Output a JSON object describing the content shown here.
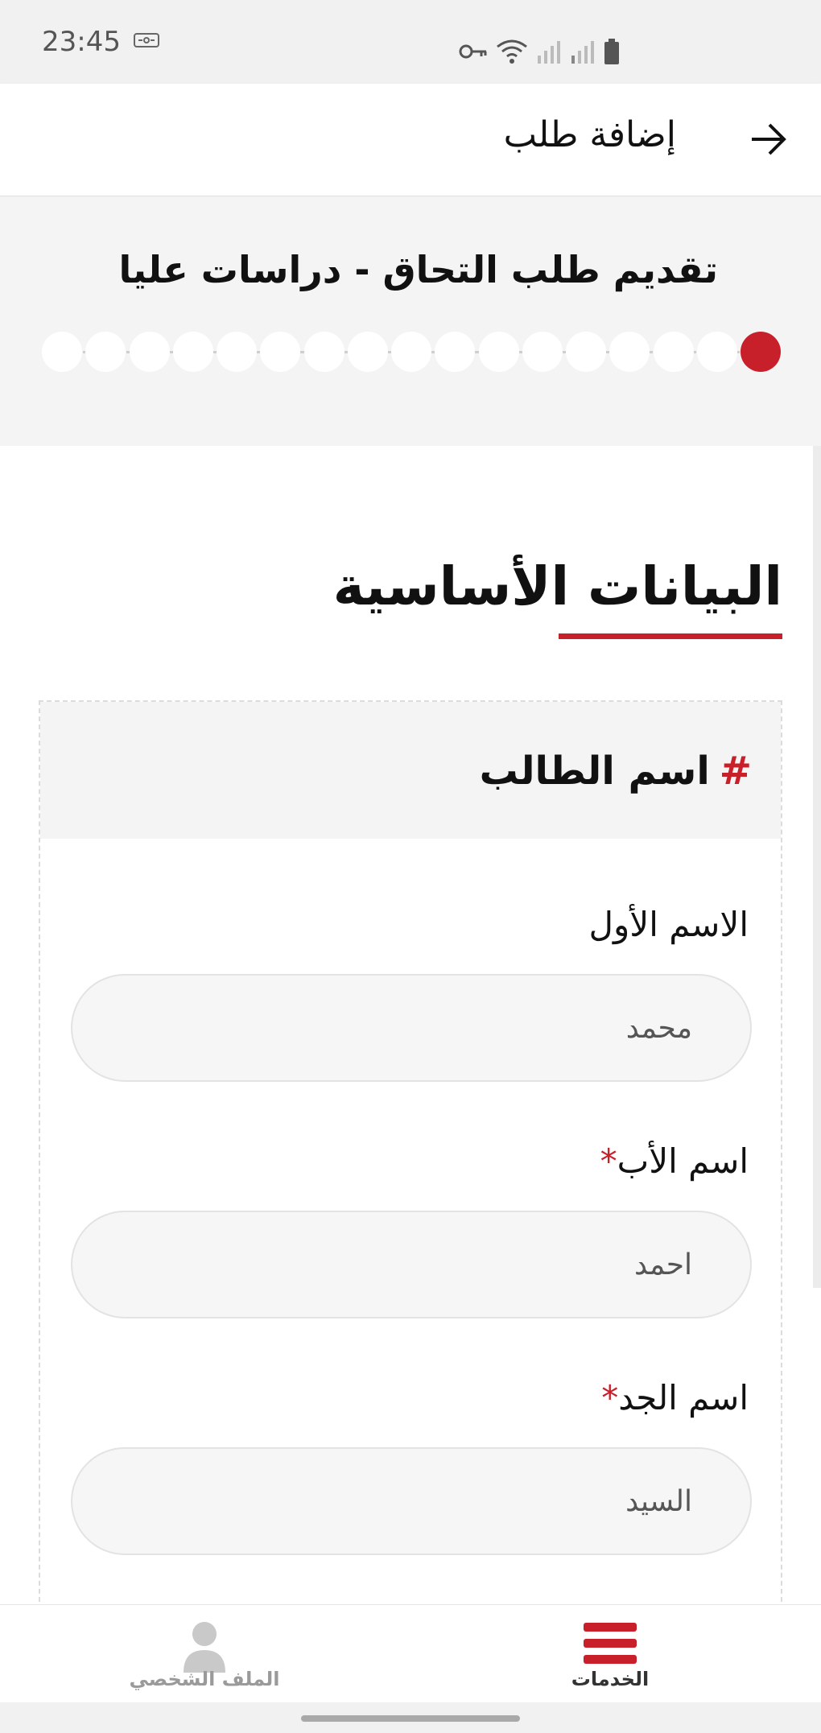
{
  "status_bar": {
    "time": "23:45"
  },
  "app_bar": {
    "title": "إضافة طلب"
  },
  "stepper": {
    "title": "تقديم طلب التحاق - دراسات عليا",
    "total_steps": 17,
    "current_step": 1
  },
  "section": {
    "title": "البيانات الأساسية"
  },
  "card": {
    "hash": "#",
    "title": "اسم الطالب",
    "fields": [
      {
        "label": "الاسم الأول",
        "required": "",
        "value": "محمد"
      },
      {
        "label": "اسم الأب",
        "required": "*",
        "value": "احمد"
      },
      {
        "label": "اسم الجد",
        "required": "*",
        "value": "السيد"
      }
    ]
  },
  "bottom_nav": {
    "services_label": "الخدمات",
    "profile_label": "الملف الشخصي"
  },
  "colors": {
    "accent": "#c8202a",
    "step_inactive": "#ffffff",
    "section_bg": "#f4f4f4"
  },
  "icons": {
    "back": "arrow-right-icon",
    "services": "menu-icon",
    "profile": "user-icon"
  }
}
